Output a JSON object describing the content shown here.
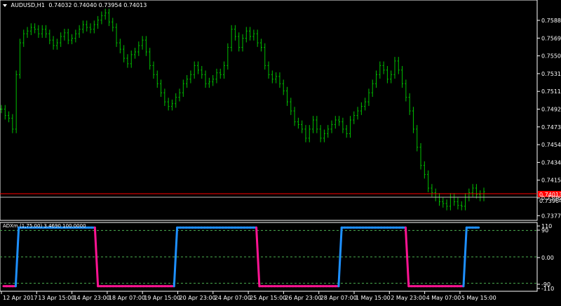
{
  "header": {
    "menu_arrow_icon": "triangle-down-icon",
    "symbol_tf": "AUDUSD,H1",
    "ohlc": "0.74032 0.74040 0.73954 0.74013"
  },
  "indicator": {
    "label": "ADXm (1,75.00) 3.4690 100.0000"
  },
  "colors": {
    "background": "#000000",
    "price_bars": "#00c000",
    "bid_line": "#c0c0c0",
    "ask_line": "#ff0000",
    "indicator_up": "#1e90ff",
    "indicator_down": "#ff1493",
    "level_lines": "#4caf50",
    "axis_text": "#ffffff"
  },
  "chart_data": [
    {
      "type": "ohlc",
      "title": "AUDUSD,H1",
      "y_ticks": [
        "0.75889",
        "0.75694",
        "0.75504",
        "0.75314",
        "0.75119",
        "0.74929",
        "0.74734",
        "0.74544",
        "0.74349",
        "0.74159",
        "0.73964",
        "0.73774"
      ],
      "ylim": [
        0.7371,
        0.7606
      ],
      "price_label_current": "0.74013",
      "price_label_ask": "0.73964",
      "x_ticks": [
        "12 Apr 2017",
        "13 Apr 15:00",
        "14 Apr 23:00",
        "18 Apr 07:00",
        "19 Apr 15:00",
        "20 Apr 23:00",
        "24 Apr 07:00",
        "25 Apr 15:00",
        "26 Apr 23:00",
        "28 Apr 07:00",
        "1 May 15:00",
        "2 May 23:00",
        "4 May 07:00",
        "5 May 15:00"
      ],
      "series": [
        {
          "values": [
            0.7492,
            0.7485,
            0.7482,
            0.747,
            0.753,
            0.7565,
            0.7575,
            0.7578,
            0.7582,
            0.758,
            0.7575,
            0.758,
            0.7575,
            0.7568,
            0.7562,
            0.7565,
            0.7572,
            0.7576,
            0.7568,
            0.757,
            0.7575,
            0.758,
            0.7585,
            0.7582,
            0.758,
            0.7585,
            0.759,
            0.7595,
            0.7598,
            0.7588,
            0.7582,
            0.7565,
            0.7558,
            0.7548,
            0.7542,
            0.7552,
            0.7555,
            0.7562,
            0.7568,
            0.7555,
            0.754,
            0.753,
            0.752,
            0.751,
            0.75,
            0.7495,
            0.7498,
            0.7505,
            0.751,
            0.752,
            0.7525,
            0.753,
            0.754,
            0.7535,
            0.753,
            0.752,
            0.7522,
            0.7525,
            0.7532,
            0.753,
            0.754,
            0.756,
            0.758,
            0.7572,
            0.756,
            0.757,
            0.7578,
            0.7572,
            0.7575,
            0.7565,
            0.756,
            0.754,
            0.753,
            0.7525,
            0.7528,
            0.752,
            0.7512,
            0.75,
            0.749,
            0.7478,
            0.7475,
            0.747,
            0.746,
            0.747,
            0.748,
            0.747,
            0.746,
            0.7465,
            0.747,
            0.7475,
            0.748,
            0.7478,
            0.747,
            0.7465,
            0.748,
            0.7485,
            0.749,
            0.7495,
            0.75,
            0.751,
            0.752,
            0.753,
            0.754,
            0.7535,
            0.7525,
            0.753,
            0.7545,
            0.7535,
            0.752,
            0.7505,
            0.749,
            0.747,
            0.745,
            0.743,
            0.742,
            0.7405,
            0.74,
            0.7395,
            0.739,
            0.7388,
            0.7385,
            0.7395,
            0.739,
            0.7386,
            0.7385,
            0.7395,
            0.74,
            0.7405,
            0.7398,
            0.7395,
            0.7401
          ]
        }
      ]
    },
    {
      "type": "line",
      "title": "ADXm (1,75.00)",
      "y_ticks": [
        "110",
        "90",
        "0.00",
        "-90",
        "-110"
      ],
      "levels": [
        90,
        0,
        -90
      ],
      "ylim": [
        -115,
        115
      ],
      "series": [
        {
          "name": "ADXm",
          "values": [
            -100,
            -100,
            -100,
            -100,
            -100,
            100,
            100,
            100,
            100,
            100,
            100,
            100,
            100,
            100,
            100,
            100,
            100,
            100,
            100,
            100,
            100,
            100,
            100,
            100,
            100,
            100,
            100,
            100,
            100,
            100,
            100,
            -100,
            -100,
            -100,
            -100,
            -100,
            -100,
            -100,
            -100,
            -100,
            -100,
            -100,
            -100,
            -100,
            -100,
            -100,
            -100,
            -100,
            -100,
            -100,
            -100,
            -100,
            -100,
            -100,
            -100,
            -100,
            -100,
            100,
            100,
            100,
            100,
            100,
            100,
            100,
            100,
            100,
            100,
            100,
            100,
            100,
            100,
            100,
            100,
            100,
            100,
            100,
            100,
            100,
            100,
            100,
            100,
            100,
            100,
            100,
            -100,
            -100,
            -100,
            -100,
            -100,
            -100,
            -100,
            -100,
            -100,
            -100,
            -100,
            -100,
            -100,
            -100,
            -100,
            -100,
            -100,
            -100,
            -100,
            -100,
            -100,
            -100,
            -100,
            -100,
            -100,
            -100,
            -100,
            100,
            100,
            100,
            100,
            100,
            100,
            100,
            100,
            100,
            100,
            100,
            100,
            100,
            100,
            100,
            100,
            100,
            100,
            100,
            100,
            100,
            100,
            -100,
            -100,
            -100,
            -100,
            -100,
            -100,
            -100,
            -100,
            -100,
            -100,
            -100,
            -100,
            -100,
            -100,
            -100,
            -100,
            -100,
            -100,
            -100,
            100,
            100,
            100,
            100,
            100
          ]
        }
      ]
    }
  ]
}
